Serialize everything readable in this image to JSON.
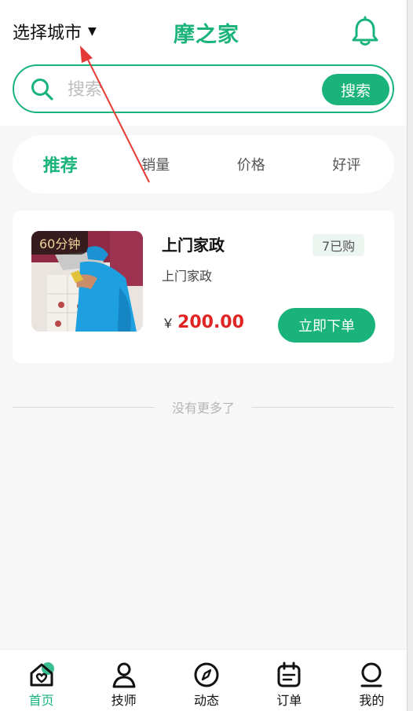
{
  "header": {
    "city_label": "选择城市",
    "city_caret": "▼",
    "brand": "摩之家",
    "bell_icon": "bell-icon"
  },
  "search": {
    "placeholder": "搜索",
    "value": "",
    "button_label": "搜索",
    "icon": "search-icon"
  },
  "tabs": [
    {
      "label": "推荐",
      "active": true
    },
    {
      "label": "销量",
      "active": false
    },
    {
      "label": "价格",
      "active": false
    },
    {
      "label": "好评",
      "active": false
    }
  ],
  "products": [
    {
      "duration": "60分钟",
      "title": "上门家政",
      "sold": "7已购",
      "subtitle": "上门家政",
      "currency": "￥",
      "price": "200.00",
      "button_label": "立即下单"
    }
  ],
  "no_more_text": "没有更多了",
  "tabbar": [
    {
      "label": "首页",
      "icon": "home-icon",
      "active": true
    },
    {
      "label": "技师",
      "icon": "person-icon",
      "active": false
    },
    {
      "label": "动态",
      "icon": "compass-icon",
      "active": false
    },
    {
      "label": "订单",
      "icon": "calendar-icon",
      "active": false
    },
    {
      "label": "我的",
      "icon": "user-circle-icon",
      "active": false
    }
  ],
  "colors": {
    "accent": "#19b37b",
    "price": "#e02424",
    "annotation_arrow": "#e53935"
  }
}
